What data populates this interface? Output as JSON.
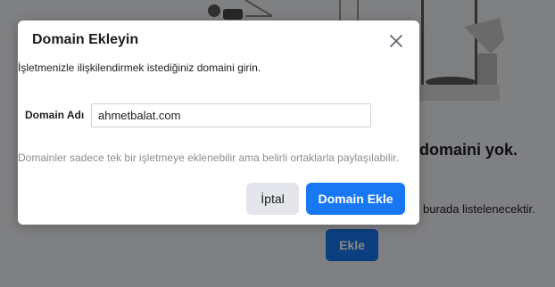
{
  "background": {
    "heading_partial": "domaini yok.",
    "description_partial": "burada listelenecektir.",
    "add_button_label": "Ekle"
  },
  "modal": {
    "title": "Domain Ekleyin",
    "intro": "İşletmenizle ilişkilendirmek istediğiniz domaini girin.",
    "field_label": "Domain Adı",
    "field_value": "ahmetbalat.com",
    "helper": "Domainler sadece tek bir işletmeye eklenebilir ama belirli ortaklarla paylaşılabilir.",
    "cancel_label": "İptal",
    "submit_label": "Domain Ekle"
  },
  "colors": {
    "primary": "#1877f2",
    "secondary_button": "#e4e6eb",
    "helper_text": "#8a8d91",
    "overlay": "rgba(0,0,0,0.47)"
  },
  "icons": {
    "close": "close-icon"
  }
}
